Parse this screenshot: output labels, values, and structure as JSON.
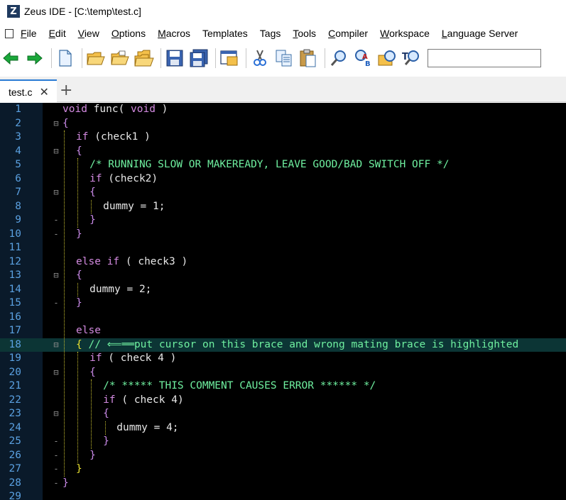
{
  "window": {
    "logo": "Z",
    "title": "Zeus IDE - [C:\\temp\\test.c]"
  },
  "menu": [
    {
      "first": "F",
      "rest": "ile"
    },
    {
      "first": "E",
      "rest": "dit"
    },
    {
      "first": "V",
      "rest": "iew"
    },
    {
      "first": "O",
      "rest": "ptions"
    },
    {
      "first": "M",
      "rest": "acros"
    },
    {
      "first": "",
      "rest": "Templates"
    },
    {
      "first": "",
      "rest": "Tags"
    },
    {
      "first": "T",
      "rest": "ools"
    },
    {
      "first": "C",
      "rest": "ompiler"
    },
    {
      "first": "W",
      "rest": "orkspace"
    },
    {
      "first": "L",
      "rest": "anguage Server"
    }
  ],
  "toolbar_icons": [
    "back-arrow-icon",
    "forward-arrow-icon",
    "new-file-icon",
    "open-folder-icon",
    "open-folder-2-icon",
    "open-folders-icon",
    "save-icon",
    "save-all-icon",
    "window-icon",
    "cut-icon",
    "copy-icon",
    "paste-icon",
    "find-icon",
    "replace-icon",
    "find-in-files-icon",
    "find-tag-icon"
  ],
  "tab": {
    "label": "test.c",
    "close": "✕",
    "add": "+"
  },
  "colors": {
    "keyword": "#d38ae0",
    "comment": "#6ff0a0",
    "line_number": "#5aa0e0",
    "highlight_brace": "#e8e030",
    "current_line": "#0c3535"
  },
  "lines": [
    {
      "n": "1",
      "fold": "",
      "indent": 0,
      "parts": [
        [
          "kw",
          "void"
        ],
        [
          "id",
          " func( "
        ],
        [
          "kw",
          "void"
        ],
        [
          "id",
          " )"
        ]
      ]
    },
    {
      "n": "2",
      "fold": "⊟",
      "indent": 0,
      "parts": [
        [
          "br",
          "{"
        ]
      ]
    },
    {
      "n": "3",
      "fold": "",
      "indent": 1,
      "parts": [
        [
          "kw",
          "if"
        ],
        [
          "id",
          " (check1 )"
        ]
      ]
    },
    {
      "n": "4",
      "fold": "⊟",
      "indent": 1,
      "parts": [
        [
          "br",
          "{"
        ]
      ]
    },
    {
      "n": "5",
      "fold": "",
      "indent": 2,
      "parts": [
        [
          "cm",
          "/* RUNNING SLOW OR MAKEREADY, LEAVE GOOD/BAD SWITCH OFF */"
        ]
      ]
    },
    {
      "n": "6",
      "fold": "",
      "indent": 2,
      "parts": [
        [
          "kw",
          "if"
        ],
        [
          "id",
          " (check2)"
        ]
      ]
    },
    {
      "n": "7",
      "fold": "⊟",
      "indent": 2,
      "parts": [
        [
          "br",
          "{"
        ]
      ]
    },
    {
      "n": "8",
      "fold": "",
      "indent": 3,
      "parts": [
        [
          "id",
          "dummy = 1;"
        ]
      ]
    },
    {
      "n": "9",
      "fold": "-",
      "indent": 2,
      "parts": [
        [
          "br",
          "}"
        ]
      ]
    },
    {
      "n": "10",
      "fold": "-",
      "indent": 1,
      "parts": [
        [
          "br",
          "}"
        ]
      ]
    },
    {
      "n": "11",
      "fold": "",
      "indent": 0,
      "parts": []
    },
    {
      "n": "12",
      "fold": "",
      "indent": 1,
      "parts": [
        [
          "kw",
          "else if"
        ],
        [
          "id",
          " ( check3 )"
        ]
      ]
    },
    {
      "n": "13",
      "fold": "⊟",
      "indent": 1,
      "parts": [
        [
          "br",
          "{"
        ]
      ]
    },
    {
      "n": "14",
      "fold": "",
      "indent": 2,
      "parts": [
        [
          "id",
          "dummy = 2;"
        ]
      ]
    },
    {
      "n": "15",
      "fold": "-",
      "indent": 1,
      "parts": [
        [
          "br",
          "}"
        ]
      ]
    },
    {
      "n": "16",
      "fold": "",
      "indent": 0,
      "parts": []
    },
    {
      "n": "17",
      "fold": "",
      "indent": 1,
      "parts": [
        [
          "kw",
          "else"
        ]
      ]
    },
    {
      "n": "18",
      "fold": "⊟",
      "indent": 1,
      "hl": true,
      "parts": [
        [
          "brh",
          "{"
        ],
        [
          "cm",
          " // ⟸══put cursor on this brace and wrong mating brace is highlighted"
        ]
      ]
    },
    {
      "n": "19",
      "fold": "",
      "indent": 2,
      "parts": [
        [
          "kw",
          "if"
        ],
        [
          "id",
          " ( check 4 )"
        ]
      ]
    },
    {
      "n": "20",
      "fold": "⊟",
      "indent": 2,
      "parts": [
        [
          "br",
          "{"
        ]
      ]
    },
    {
      "n": "21",
      "fold": "",
      "indent": 3,
      "parts": [
        [
          "cm",
          "/* ***** THIS COMMENT CAUSES ERROR ****** */"
        ]
      ]
    },
    {
      "n": "22",
      "fold": "",
      "indent": 3,
      "parts": [
        [
          "kw",
          "if"
        ],
        [
          "id",
          " ( check 4)"
        ]
      ]
    },
    {
      "n": "23",
      "fold": "⊟",
      "indent": 3,
      "parts": [
        [
          "br",
          "{"
        ]
      ]
    },
    {
      "n": "24",
      "fold": "",
      "indent": 4,
      "parts": [
        [
          "id",
          "dummy = 4;"
        ]
      ]
    },
    {
      "n": "25",
      "fold": "-",
      "indent": 3,
      "parts": [
        [
          "br",
          "}"
        ]
      ]
    },
    {
      "n": "26",
      "fold": "-",
      "indent": 2,
      "parts": [
        [
          "br",
          "}"
        ]
      ]
    },
    {
      "n": "27",
      "fold": "-",
      "indent": 1,
      "parts": [
        [
          "brh",
          "}"
        ]
      ]
    },
    {
      "n": "28",
      "fold": "-",
      "indent": 0,
      "parts": [
        [
          "br",
          "}"
        ]
      ]
    },
    {
      "n": "29",
      "fold": "",
      "indent": 0,
      "parts": []
    }
  ]
}
